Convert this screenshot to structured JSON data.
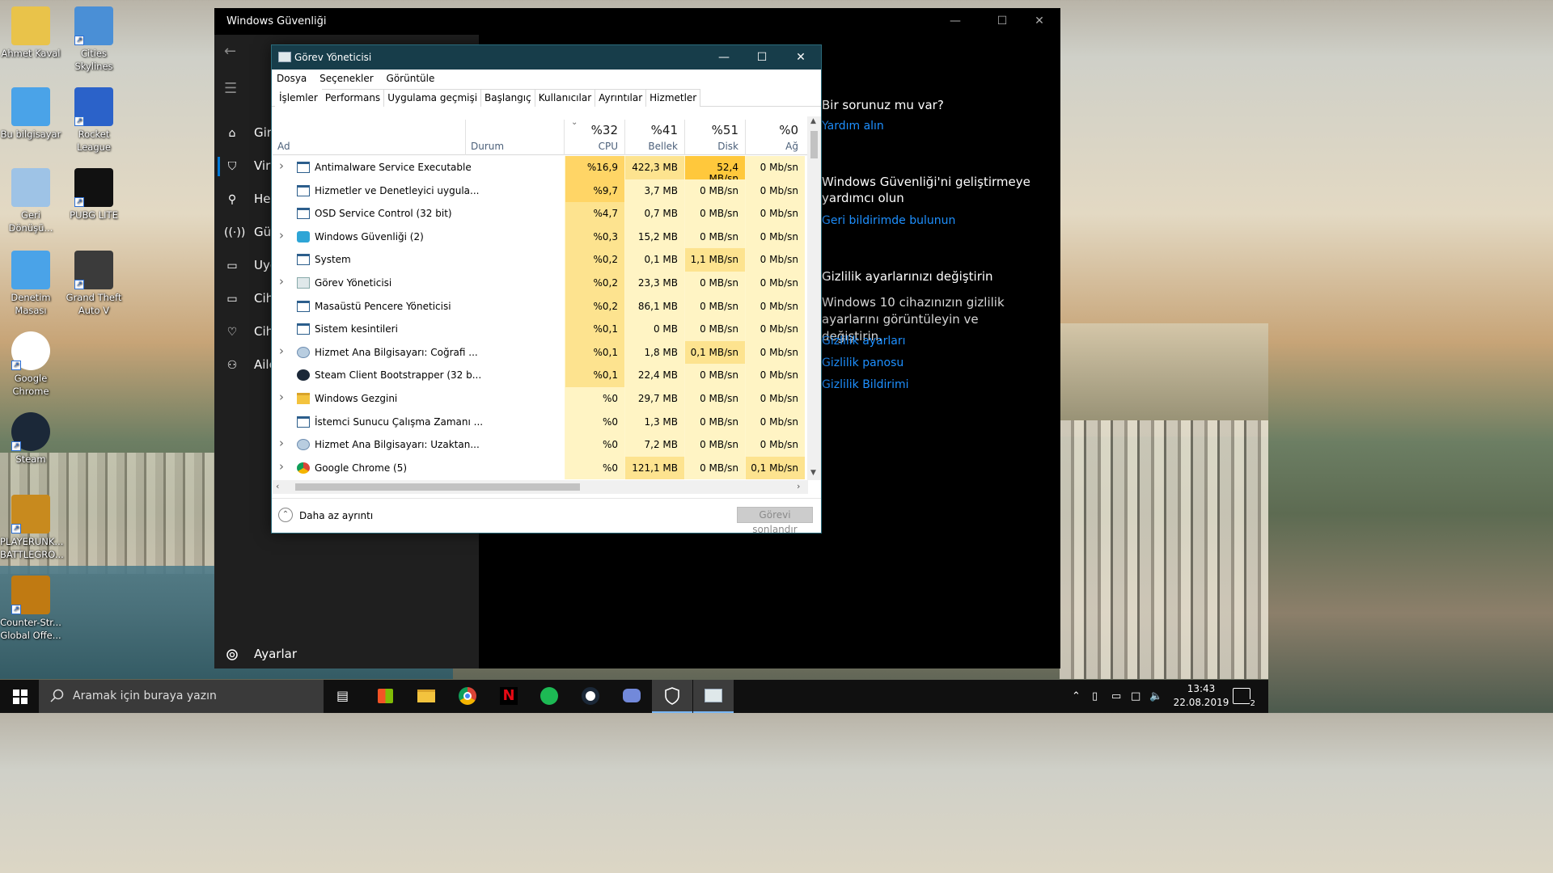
{
  "desktop": {
    "icons": [
      {
        "label": "Ahmet Kaval",
        "icon": "user-folder-icon"
      },
      {
        "label": "Cities Skylines",
        "icon": "cities-skylines-icon"
      },
      {
        "label": "Bu bilgisayar",
        "icon": "computer-icon"
      },
      {
        "label": "Rocket League",
        "icon": "rocket-league-icon"
      },
      {
        "label": "Geri Dönüşü...",
        "icon": "recycle-bin-icon"
      },
      {
        "label": "PUBG LITE",
        "icon": "pubg-lite-icon"
      },
      {
        "label": "Denetim Masası",
        "icon": "control-panel-icon"
      },
      {
        "label": "Grand Theft Auto V",
        "icon": "gta-v-icon"
      },
      {
        "label": "Google Chrome",
        "icon": "chrome-icon"
      },
      {
        "label": "Steam",
        "icon": "steam-icon"
      },
      {
        "label": "PLAYERUNK... BATTLEGRO...",
        "icon": "pubg-icon"
      },
      {
        "label": "Counter-Str... Global Offe...",
        "icon": "csgo-icon"
      }
    ]
  },
  "security": {
    "title": "Windows Güvenliği",
    "nav": [
      "Giriş",
      "Virüs",
      "Hesap",
      "Güvenlik",
      "Uygulama",
      "Cihaz",
      "Cihaz",
      "Aile"
    ],
    "nav_visible": [
      "Giri",
      "Vir",
      "Hes",
      "Güv",
      "Uyg",
      "Cih",
      "Cih",
      "Aile"
    ],
    "settings": "Ayarlar",
    "side": {
      "q_title": "Bir sorunuz mu var?",
      "q_link": "Yardım alın",
      "improve_title": "Windows Güvenliği'ni geliştirmeye yardımcı olun",
      "improve_link": "Geri bildirimde bulunun",
      "privacy_title": "Gizlilik ayarlarınızı değiştirin",
      "privacy_text": "Windows 10 cihazınızın gizlilik ayarlarını görüntüleyin ve değiştirin.",
      "privacy_links": [
        "Gizlilik ayarları",
        "Gizlilik panosu",
        "Gizlilik Bildirimi"
      ]
    }
  },
  "taskmgr": {
    "title": "Görev Yöneticisi",
    "menu": [
      "Dosya",
      "Seçenekler",
      "Görüntüle"
    ],
    "tabs": [
      "İşlemler",
      "Performans",
      "Uygulama geçmişi",
      "Başlangıç",
      "Kullanıcılar",
      "Ayrıntılar",
      "Hizmetler"
    ],
    "columns": {
      "name": "Ad",
      "status": "Durum",
      "cpu": {
        "pct": "%32",
        "label": "CPU"
      },
      "mem": {
        "pct": "%41",
        "label": "Bellek"
      },
      "disk": {
        "pct": "%51",
        "label": "Disk"
      },
      "net": {
        "pct": "%0",
        "label": "Ağ"
      }
    },
    "rows": [
      {
        "name": "Antimalware Service Executable",
        "expand": true,
        "cpu": "%16,9",
        "mem": "422,3 MB",
        "disk": "52,4 MB/sn",
        "net": "0 Mb/sn",
        "icon": "app-window-icon"
      },
      {
        "name": "Hizmetler ve Denetleyici uygula...",
        "expand": false,
        "cpu": "%9,7",
        "mem": "3,7 MB",
        "disk": "0 MB/sn",
        "net": "0 Mb/sn",
        "icon": "app-window-icon"
      },
      {
        "name": "OSD Service Control (32 bit)",
        "expand": false,
        "cpu": "%4,7",
        "mem": "0,7 MB",
        "disk": "0 MB/sn",
        "net": "0 Mb/sn",
        "icon": "app-window-icon"
      },
      {
        "name": "Windows Güvenliği (2)",
        "expand": true,
        "cpu": "%0,3",
        "mem": "15,2 MB",
        "disk": "0 MB/sn",
        "net": "0 Mb/sn",
        "icon": "shield-icon"
      },
      {
        "name": "System",
        "expand": false,
        "cpu": "%0,2",
        "mem": "0,1 MB",
        "disk": "1,1 MB/sn",
        "net": "0 Mb/sn",
        "icon": "app-window-icon"
      },
      {
        "name": "Görev Yöneticisi",
        "expand": true,
        "cpu": "%0,2",
        "mem": "23,3 MB",
        "disk": "0 MB/sn",
        "net": "0 Mb/sn",
        "icon": "taskmgr-icon"
      },
      {
        "name": "Masaüstü Pencere Yöneticisi",
        "expand": false,
        "cpu": "%0,2",
        "mem": "86,1 MB",
        "disk": "0 MB/sn",
        "net": "0 Mb/sn",
        "icon": "app-window-icon"
      },
      {
        "name": "Sistem kesintileri",
        "expand": false,
        "cpu": "%0,1",
        "mem": "0 MB",
        "disk": "0 MB/sn",
        "net": "0 Mb/sn",
        "icon": "app-window-icon"
      },
      {
        "name": "Hizmet Ana Bilgisayarı: Coğrafi ...",
        "expand": true,
        "cpu": "%0,1",
        "mem": "1,8 MB",
        "disk": "0,1 MB/sn",
        "net": "0 Mb/sn",
        "icon": "gear-icon"
      },
      {
        "name": "Steam Client Bootstrapper (32 b...",
        "expand": false,
        "cpu": "%0,1",
        "mem": "22,4 MB",
        "disk": "0 MB/sn",
        "net": "0 Mb/sn",
        "icon": "steam-icon"
      },
      {
        "name": "Windows Gezgini",
        "expand": true,
        "cpu": "%0",
        "mem": "29,7 MB",
        "disk": "0 MB/sn",
        "net": "0 Mb/sn",
        "icon": "folder-icon"
      },
      {
        "name": "İstemci Sunucu Çalışma Zamanı ...",
        "expand": false,
        "cpu": "%0",
        "mem": "1,3 MB",
        "disk": "0 MB/sn",
        "net": "0 Mb/sn",
        "icon": "app-window-icon"
      },
      {
        "name": "Hizmet Ana Bilgisayarı: Uzaktan...",
        "expand": true,
        "cpu": "%0",
        "mem": "7,2 MB",
        "disk": "0 MB/sn",
        "net": "0 Mb/sn",
        "icon": "gear-icon"
      },
      {
        "name": "Google Chrome (5)",
        "expand": true,
        "cpu": "%0",
        "mem": "121,1 MB",
        "disk": "0 MB/sn",
        "net": "0,1 Mb/sn",
        "icon": "chrome-icon"
      }
    ],
    "less_detail": "Daha az ayrıntı",
    "end_task": "Görevi sonlandır"
  },
  "taskbar": {
    "search_placeholder": "Aramak için buraya yazın",
    "time": "13:43",
    "date": "22.08.2019",
    "notifications": "2"
  },
  "colors": {
    "heat_high": "#ffd566",
    "heat_med": "#fde38f",
    "heat_low": "#fff4c4",
    "heat_disk": "#ffc83c",
    "link": "#1e90ff",
    "tm_title": "#173d4a"
  }
}
